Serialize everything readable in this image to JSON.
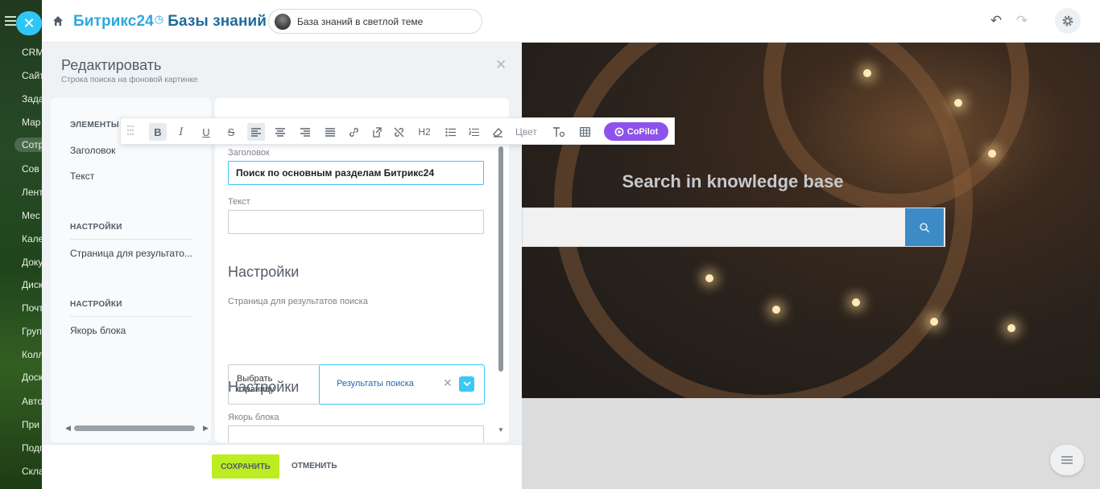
{
  "left_nav": {
    "items": [
      {
        "label": "CRM",
        "highlight": false
      },
      {
        "label": "Сайт",
        "highlight": false
      },
      {
        "label": "Зада",
        "highlight": false
      },
      {
        "label": "Мар",
        "highlight": false
      },
      {
        "label": "Сотр",
        "highlight": true
      },
      {
        "label": "Сов",
        "highlight": false
      },
      {
        "label": "Лент",
        "highlight": false
      },
      {
        "label": "Мес",
        "highlight": false
      },
      {
        "label": "Кале",
        "highlight": false
      },
      {
        "label": "Доку",
        "highlight": false
      },
      {
        "label": "Диск",
        "highlight": false
      },
      {
        "label": "Почт",
        "highlight": false
      },
      {
        "label": "Груп",
        "highlight": false
      },
      {
        "label": "Колл",
        "highlight": false
      },
      {
        "label": "Доск",
        "highlight": false
      },
      {
        "label": "Авто",
        "highlight": false
      },
      {
        "label": "При",
        "highlight": false
      },
      {
        "label": "Подп",
        "highlight": false
      },
      {
        "label": "Скла",
        "highlight": false
      }
    ]
  },
  "topbar": {
    "logo_brand": "Битрикс24",
    "logo_section": "Базы знаний",
    "site_selector": "База знаний в светлой теме"
  },
  "panel": {
    "title": "Редактировать",
    "subtitle": "Строка поиска на фоновой картинке",
    "nav": {
      "section_elements": "ЭЛЕМЕНТЫ Б",
      "item_heading": "Заголовок",
      "item_text": "Текст",
      "section_settings_1": "НАСТРОЙКИ",
      "item_results_page": "Страница для результато...",
      "section_settings_2": "НАСТРОЙКИ",
      "item_anchor": "Якорь блока"
    },
    "form": {
      "heading_label": "Заголовок",
      "heading_value": "Поиск по основным разделам Битрикс24",
      "text_label": "Текст",
      "text_value": "",
      "settings_title_1": "Настройки",
      "results_page_label": "Страница для результатов поиска",
      "pick_page_label": "Выбрать страницу",
      "selected_page": "Результаты поиска",
      "settings_title_2": "Настройки",
      "anchor_label": "Якорь блока"
    },
    "footer": {
      "save_label": "СОХРАНИТЬ",
      "cancel_label": "ОТМЕНИТЬ"
    }
  },
  "toolbar": {
    "buttons": [
      "B",
      "I",
      "U",
      "S",
      "H2",
      "Цвет"
    ],
    "color_label": "Цвет",
    "h2_label": "H2",
    "copilot_label": "CoPilot"
  },
  "hero": {
    "title": "Search in knowledge base"
  },
  "colors": {
    "accent": "#2fc6f6",
    "save_green": "#bbed21",
    "copilot_purple": "#8e52ec",
    "search_button": "#3d8bc6"
  }
}
